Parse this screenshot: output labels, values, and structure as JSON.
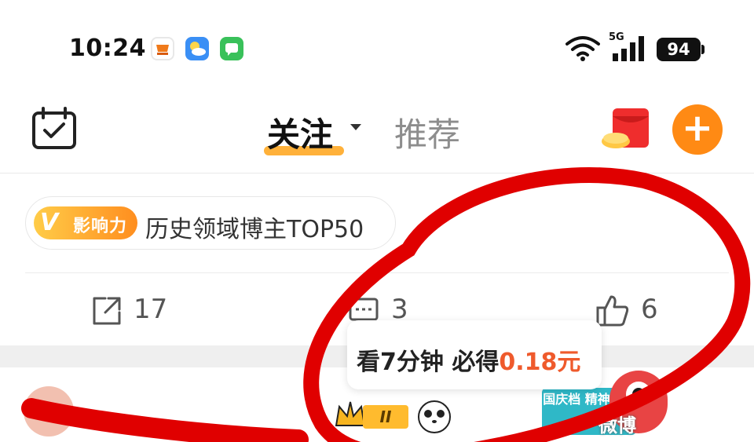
{
  "status_bar": {
    "time": "10:24",
    "network": "5G",
    "battery": "94"
  },
  "header": {
    "tabs": [
      {
        "label": "关注",
        "active": true
      },
      {
        "label": "推荐",
        "active": false
      }
    ],
    "add_label": "+"
  },
  "influence": {
    "badge_letter": "V",
    "badge_text": "影响力",
    "title": "历史领域博主TOP50"
  },
  "actions": {
    "share_count": "17",
    "comment_count": "3",
    "like_count": "6"
  },
  "tooltip": {
    "prefix": "看7分钟 必得",
    "amount": "0.18元"
  },
  "next_post": {
    "level": "II",
    "promo_text": "国庆档 精神股东"
  },
  "watermark": "微博",
  "colors": {
    "accent_orange": "#ff8a14",
    "tab_underline": "#ffb13a",
    "reward_red": "#ef5a2c",
    "annotation_red": "#e00000"
  }
}
